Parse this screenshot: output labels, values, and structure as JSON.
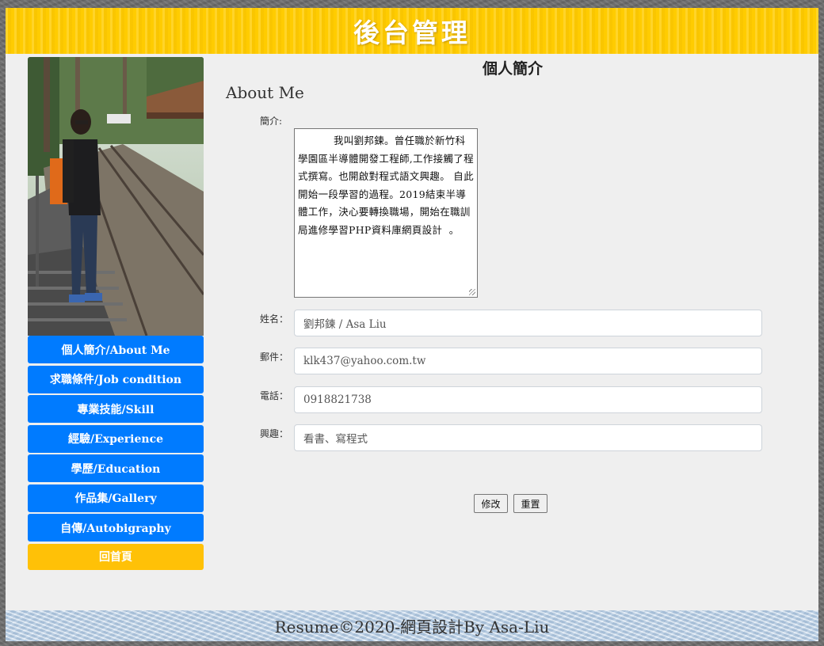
{
  "header": {
    "title": "後台管理"
  },
  "sidebar": {
    "items": [
      {
        "label": "個人簡介/About Me"
      },
      {
        "label": "求職條件/Job condition"
      },
      {
        "label": "專業技能/Skill"
      },
      {
        "label": "經驗/Experience"
      },
      {
        "label": "學歷/Education"
      },
      {
        "label": "作品集/Gallery"
      },
      {
        "label": "自傳/Autobigraphy"
      }
    ],
    "home_label": "回首頁"
  },
  "main": {
    "title": "個人簡介",
    "subtitle": "About Me",
    "form": {
      "bio_label": "簡介:",
      "bio_value": "我叫劉邦鍊。曾任職於新竹科學園區半導體開發工程師,工作接觸了程式撰寫。也開啟對程式語文興趣。 自此開始一段學習的過程。2019結束半導體工作，決心要轉換職場，開始在職訓局進修學習PHP資料庫網頁設計  。",
      "name_label": "姓名：",
      "name_value": "劉邦鍊 / Asa Liu",
      "email_label": "郵件：",
      "email_value": "klk437@yahoo.com.tw",
      "phone_label": "電話：",
      "phone_value": "0918821738",
      "hobby_label": "興趣：",
      "hobby_value": "看書、寫程式",
      "submit_label": "修改",
      "reset_label": "重置"
    }
  },
  "footer": {
    "text": "Resume©2020-網頁設計By Asa-Liu"
  },
  "colors": {
    "header_bg": "#ffcc00",
    "menu_bg": "#007bff",
    "home_bg": "#ffc107",
    "page_bg": "#efefef"
  }
}
